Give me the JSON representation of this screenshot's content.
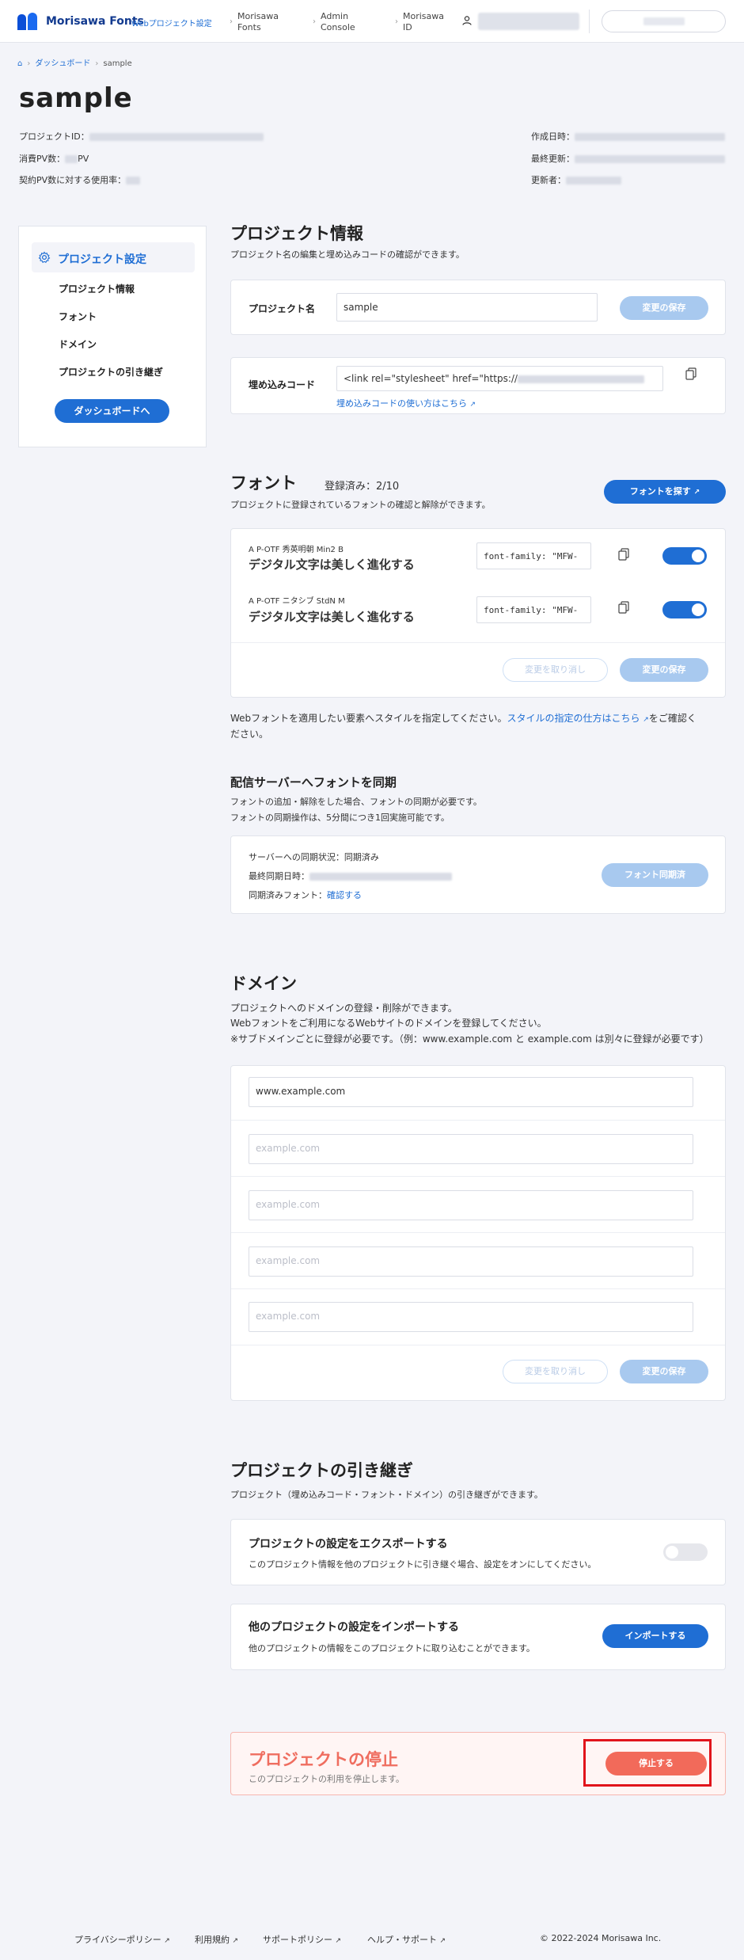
{
  "header": {
    "brand": "Morisawa Fonts",
    "brand_sub": "Webプロジェクト設定",
    "nav": [
      {
        "line1": "Morisawa",
        "line2": "Fonts"
      },
      {
        "line1": "Admin",
        "line2": "Console"
      },
      {
        "line1": "Morisawa",
        "line2": "ID"
      }
    ]
  },
  "breadcrumb": {
    "dashboard": "ダッシュボード",
    "current": "sample"
  },
  "project": {
    "title": "sample",
    "id_label": "プロジェクトID：",
    "pv_label": "消費PV数：",
    "pv_unit": "PV",
    "usage_label": "契約PV数に対する使用率：",
    "created_label": "作成日時：",
    "updated_label": "最終更新：",
    "updater_label": "更新者："
  },
  "sidebar": {
    "heading": "プロジェクト設定",
    "items": [
      "プロジェクト情報",
      "フォント",
      "ドメイン",
      "プロジェクトの引き継ぎ"
    ],
    "dashboard_button": "ダッシュボードへ"
  },
  "info": {
    "title": "プロジェクト情報",
    "subtitle": "プロジェクト名の編集と埋め込みコードの確認ができます。",
    "name_label": "プロジェクト名",
    "name_value": "sample",
    "save": "変更の保存",
    "embed_label": "埋め込みコード",
    "embed_value": "<link rel=\"stylesheet\" href=\"https://",
    "embed_help": "埋め込みコードの使い方はこちら"
  },
  "fonts": {
    "title": "フォント",
    "count": "登録済み：2/10",
    "subtitle": "プロジェクトに登録されているフォントの確認と解除ができます。",
    "find_button": "フォントを探す",
    "items": [
      {
        "name": "A P-OTF 秀英明朝 Min2 B",
        "sample": "デジタル文字は美しく進化する",
        "css": "font-family: \"MFW-"
      },
      {
        "name": "A P-OTF ニタシブ StdN M",
        "sample": "デジタル文字は美しく進化する",
        "css": "font-family: \"MFW-"
      }
    ],
    "cancel": "変更を取り消し",
    "save": "変更の保存",
    "note_prefix": "Webフォントを適用したい要素へスタイルを指定してください。",
    "note_link": "スタイルの指定の仕方はこちら",
    "note_suffix": "をご確認く",
    "note_line2": "ださい。"
  },
  "sync": {
    "title": "配信サーバーへフォントを同期",
    "sub1": "フォントの追加・解除をした場合、フォントの同期が必要です。",
    "sub2": "フォントの同期操作は、5分間につき1回実施可能です。",
    "status": "サーバーへの同期状況：同期済み",
    "last_label": "最終同期日時：",
    "synced_label": "同期済みフォント：",
    "synced_link": "確認する",
    "button": "フォント同期済"
  },
  "domain": {
    "title": "ドメイン",
    "sub1": "プロジェクトへのドメインの登録・削除ができます。",
    "sub2": "Webフォントをご利用になるWebサイトのドメインを登録してください。",
    "sub3": "※サブドメインごとに登録が必要です。（例：www.example.com と example.com は別々に登録が必要です）",
    "inputs": [
      {
        "value": "www.example.com",
        "placeholder": ""
      },
      {
        "value": "",
        "placeholder": "example.com"
      },
      {
        "value": "",
        "placeholder": "example.com"
      },
      {
        "value": "",
        "placeholder": "example.com"
      },
      {
        "value": "",
        "placeholder": "example.com"
      }
    ],
    "cancel": "変更を取り消し",
    "save": "変更の保存"
  },
  "transfer": {
    "title": "プロジェクトの引き継ぎ",
    "subtitle": "プロジェクト（埋め込みコード・フォント・ドメイン）の引き継ぎができます。",
    "export_title": "プロジェクトの設定をエクスポートする",
    "export_desc": "このプロジェクト情報を他のプロジェクトに引き継ぐ場合、設定をオンにしてください。",
    "import_title": "他のプロジェクトの設定をインポートする",
    "import_desc": "他のプロジェクトの情報をこのプロジェクトに取り込むことができます。",
    "import_button": "インポートする"
  },
  "stop": {
    "title": "プロジェクトの停止",
    "desc": "このプロジェクトの利用を停止します。",
    "button": "停止する"
  },
  "footer": {
    "links": [
      "プライバシーポリシー",
      "利用規約",
      "サポートポリシー",
      "ヘルプ・サポート"
    ],
    "copyright": "© 2022-2024 Morisawa Inc."
  }
}
